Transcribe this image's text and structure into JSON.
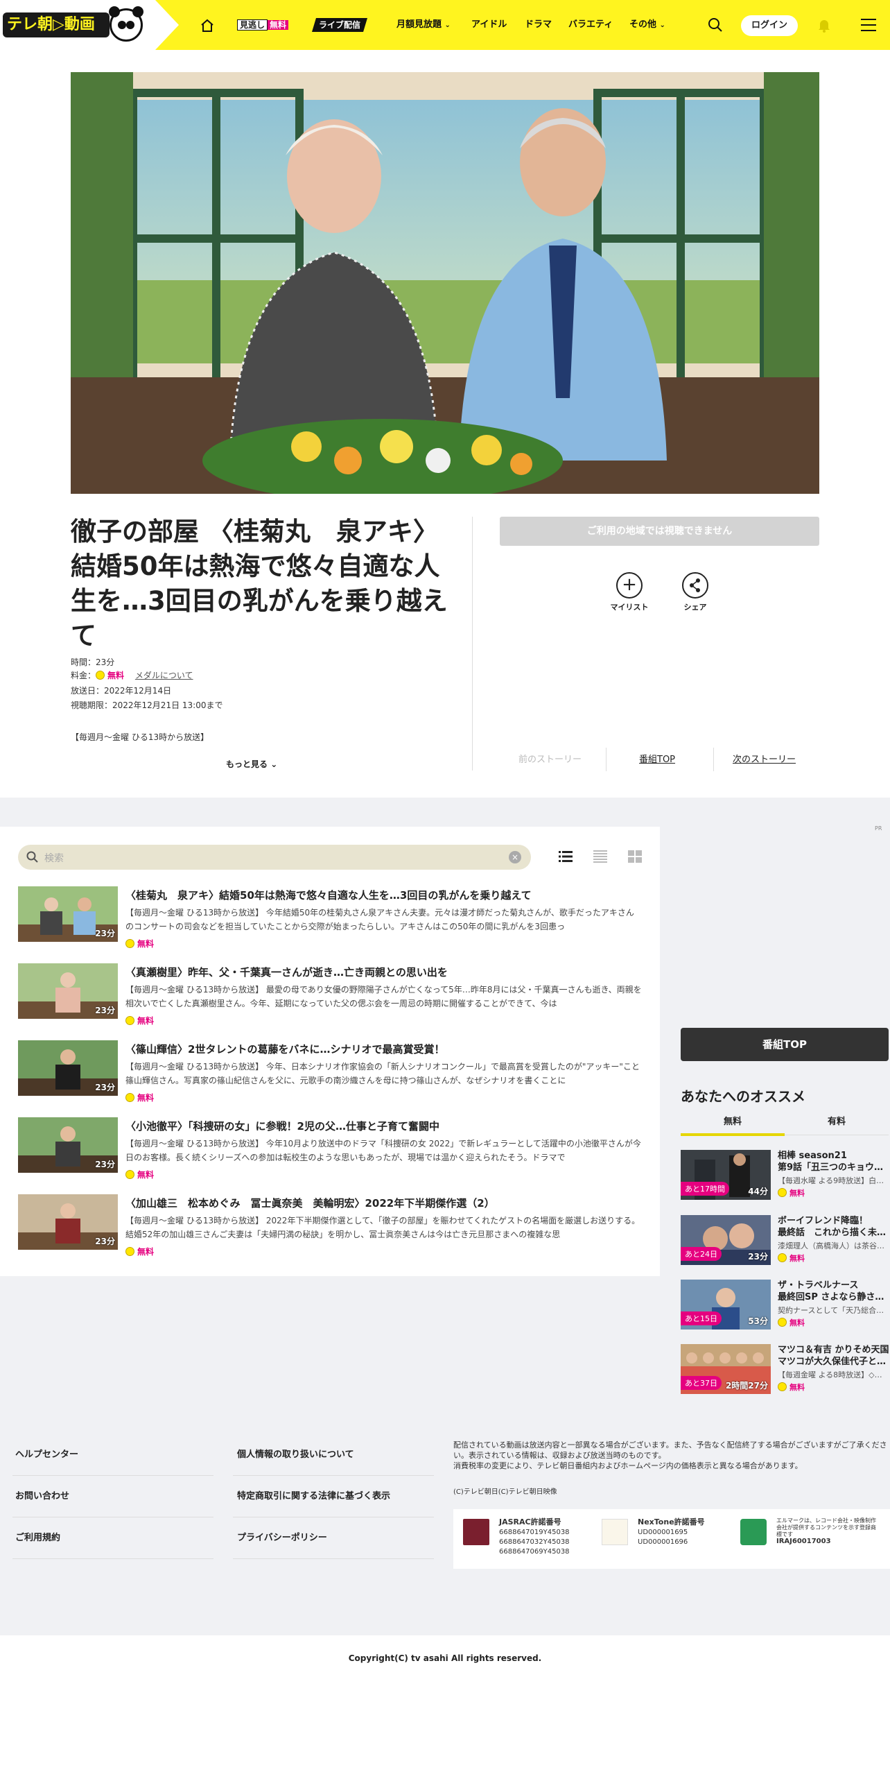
{
  "header": {
    "logo_text": "テレ朝▷動画",
    "nav": {
      "home_icon": "home-icon",
      "missed": "見逃し",
      "missed_free": "無料",
      "live": "ライブ配信",
      "monthly": "月額見放題",
      "idol": "アイドル",
      "drama": "ドラマ",
      "variety": "バラエティ",
      "other": "その他"
    },
    "login": "ログイン",
    "accent": "#fff41f"
  },
  "program": {
    "title": "徹子の部屋 〈桂菊丸　泉アキ〉結婚50年は熱海で悠々自適な人生を…3回目の乳がんを乗り越えて",
    "duration": "時間：23分",
    "price_label": "料金：",
    "price_value": "無料",
    "medal_link": "メダルについて",
    "air_date": "放送日：2022年12月14日",
    "period": "視聴期限：2022年12月21日 13:00まで",
    "schedule": "【毎週月～金曜 ひる13時から放送】",
    "more": "もっと見る",
    "unavailable": "ご利用の地域では視聴できません",
    "mylist": "マイリスト",
    "share": "シェア",
    "prev": "前のストーリー",
    "top": "番組TOP",
    "next": "次のストーリー"
  },
  "pr": "PR",
  "search": {
    "placeholder": "検索"
  },
  "episodes": [
    {
      "title": "〈桂菊丸　泉アキ〉結婚50年は熱海で悠々自適な人生を…3回目の乳がんを乗り越えて",
      "desc": "【毎週月～金曜 ひる13時から放送】 今年結婚50年の桂菊丸さん泉アキさん夫妻。元々は漫才師だった菊丸さんが、歌手だったアキさんのコンサートの司会などを担当していたことから交際が始まったらしい。アキさんはこの50年の間に乳がんを3回患っ",
      "duration": "23分",
      "price": "無料"
    },
    {
      "title": "〈真瀬樹里〉昨年、父・千葉真一さんが逝き…亡き両親との思い出を",
      "desc": "【毎週月～金曜 ひる13時から放送】 最愛の母であり女優の野際陽子さんが亡くなって5年…昨年8月には父・千葉真一さんも逝き、両親を相次いで亡くした真瀬樹里さん。今年、延期になっていた父の偲ぶ会を一周忌の時期に開催することができて、今は",
      "duration": "23分",
      "price": "無料"
    },
    {
      "title": "〈篠山輝信〉2世タレントの葛藤をバネに…シナリオで最高賞受賞！",
      "desc": "【毎週月～金曜 ひる13時から放送】 今年、日本シナリオ作家協会の「新人シナリオコンクール」で最高賞を受賞したのが\"アッキー\"こと篠山輝信さん。写真家の篠山紀信さんを父に、元歌手の南沙織さんを母に持つ篠山さんが、なぜシナリオを書くことに",
      "duration": "23分",
      "price": "無料"
    },
    {
      "title": "〈小池徹平〉「科捜研の女」に参戦！2児の父…仕事と子育て奮闘中",
      "desc": "【毎週月～金曜 ひる13時から放送】 今年10月より放送中のドラマ「科捜研の女 2022」で新レギュラーとして活躍中の小池徹平さんが今日のお客様。長く続くシリーズへの参加は転校生のような思いもあったが、現場では温かく迎えられたそう。ドラマで",
      "duration": "23分",
      "price": "無料"
    },
    {
      "title": "〈加山雄三　松本めぐみ　冨士眞奈美　美輪明宏〉2022年下半期傑作選（2）",
      "desc": "【毎週月～金曜 ひる13時から放送】 2022年下半期傑作選として、「徹子の部屋」を賑わせてくれたゲストの名場面を厳選しお送りする。 結婚52年の加山雄三さんご夫妻は「夫婦円満の秘訣」を明かし、冨士眞奈美さんは今は亡き元旦那さまへの複雑な思",
      "duration": "23分",
      "price": "無料"
    }
  ],
  "sidebar": {
    "top_button": "番組TOP",
    "rec_title": "あなたへのオススメ",
    "tab_free": "無料",
    "tab_paid": "有料",
    "items": [
      {
        "t1": "相棒 season21",
        "t2": "第9話「丑三つのキョウ…",
        "t3": "【毎週水曜 よる9時放送】白…",
        "label": "あと17時間",
        "duration": "44分",
        "price": "無料"
      },
      {
        "t1": "ボーイフレンド降臨！",
        "t2": "最終話　これから描く未…",
        "t3": "漆畑理人（高橋海人）は茶谷…",
        "label": "あと24日",
        "duration": "23分",
        "price": "無料"
      },
      {
        "t1": "ザ・トラベルナース",
        "t2": "最終回SP さよなら静さ…",
        "t3": "契約ナースとして「天乃総合…",
        "label": "あと15日",
        "duration": "53分",
        "price": "無料"
      },
      {
        "t1": "マツコ＆有吉 かりそめ天国",
        "t2": "マツコが大久保佳代子と…",
        "t3": "【毎週金曜 よる8時放送】◇…",
        "label": "あと37日",
        "duration": "2時間27分",
        "price": "無料"
      }
    ]
  },
  "footer": {
    "col1": [
      "ヘルプセンター",
      "お問い合わせ",
      "ご利用規約"
    ],
    "col2": [
      "個人情報の取り扱いについて",
      "特定商取引に関する法律に基づく表示",
      "プライバシーポリシー"
    ],
    "notice": "配信されている動画は放送内容と一部異なる場合がございます。また、予告なく配信終了する場合がございますがご了承ください。表示されている情報は、収録および放送当時のものです。\n消費税率の変更により、テレビ朝日番組内およびホームページ内の価格表示と異なる場合があります。",
    "credit": "(C)テレビ朝日(C)テレビ朝日映像",
    "jasrac_title": "JASRAC許諾番号",
    "jasrac_1": "6688647019Y45038",
    "jasrac_2": "6688647032Y45038",
    "jasrac_3": "6688647069Y45038",
    "nextone_title": "NexTone許諾番号",
    "nextone_1": "UD000001695",
    "nextone_2": "UD000001696",
    "lmark_text": "エルマークは、レコード会社・映像制作会社が提供するコンテンツを示す登録商標です",
    "lmark_code": "IRAJ60017003",
    "copyright": "Copyright(C) tv asahi All rights reserved."
  }
}
